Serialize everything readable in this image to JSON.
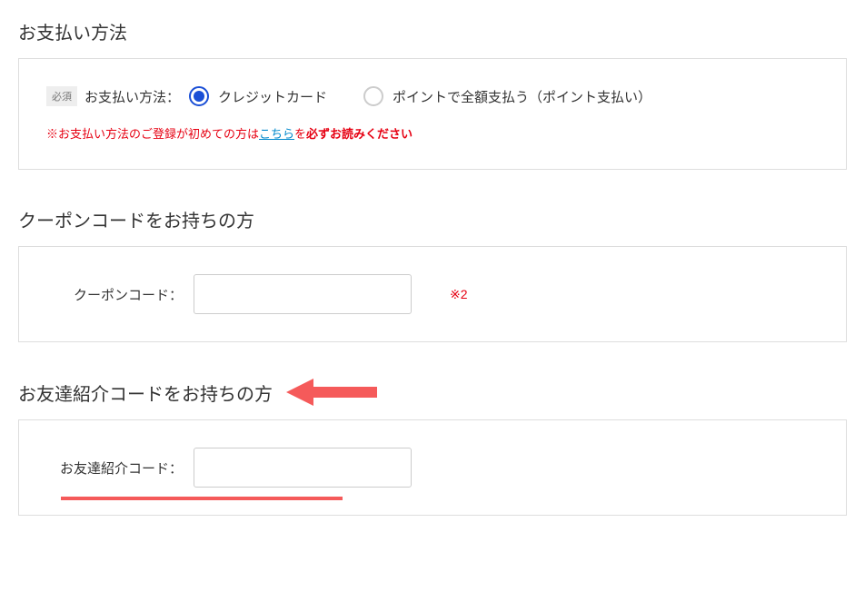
{
  "payment": {
    "title": "お支払い方法",
    "required_badge": "必須",
    "label": "お支払い方法：",
    "options": {
      "credit": "クレジットカード",
      "points": "ポイントで全額支払う（ポイント支払い）"
    },
    "notice_prefix": "※お支払い方法のご登録が初めての方は",
    "notice_link": "こちら",
    "notice_suffix_1": "を",
    "notice_suffix_2": "必ずお読みください"
  },
  "coupon": {
    "title": "クーポンコードをお持ちの方",
    "label": "クーポンコード：",
    "note": "※2"
  },
  "referral": {
    "title": "お友達紹介コードをお持ちの方",
    "label": "お友達紹介コード："
  }
}
